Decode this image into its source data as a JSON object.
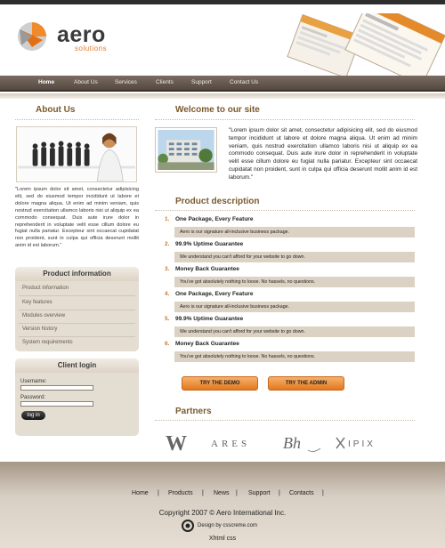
{
  "brand": {
    "name": "aero",
    "tagline": "solutions"
  },
  "nav": {
    "items": [
      {
        "label": "Home",
        "active": true
      },
      {
        "label": "About Us"
      },
      {
        "label": "Services"
      },
      {
        "label": "Clients"
      },
      {
        "label": "Support"
      },
      {
        "label": "Contact Us"
      }
    ]
  },
  "about": {
    "title": "About Us",
    "text": "\"Lorem ipsum dolor sit amet, consectetur adipisicing elit, sed do eiusmod tempor incididunt ut labore et dolore magna aliqua. Ut enim ad minim veniam, quis nostrud exercitation ullamco laboris nisi ut aliquip ex ea commodo consequat. Duis aute irure dolor in reprehenderit in voluptate velit esse cillum dolore eu fugiat nulla pariatur. Excepteur sint occaecat cupidatat non proident, sunt in culpa qui officia deserunt mollit anim id est laborum.\""
  },
  "product_info": {
    "title": "Product information",
    "items": [
      "Product information",
      "Key features",
      "Modules overview",
      "Version history",
      "System requirements"
    ]
  },
  "login": {
    "title": "Client login",
    "username_label": "Username:",
    "password_label": "Password:",
    "button_label": "log in"
  },
  "welcome": {
    "title": "Welcome to our site",
    "text": "\"Lorem ipsum dolor sit amet, consectetur adipisicing elit, sed do eiusmod tempor incididunt ut labore et dolore magna aliqua. Ut enim ad minim veniam, quis nostrud exercitation ullamco laboris nisi ut aliquip ex ea commodo consequat. Duis aute irure dolor in reprehenderit in voluptate velit esse cillum dolore eu fugiat nulla pariatur. Excepteur sint occaecat cupidatat non proident, sunt in culpa qui officia deserunt mollit anim id est laborum.\""
  },
  "product_description": {
    "title": "Product description",
    "items": [
      {
        "num": "1.",
        "title": "One Package, Every Feature",
        "text": "Aero is our signature all-inclusive business package."
      },
      {
        "num": "2.",
        "title": "99.9% Uptime Guarantee",
        "text": "We understand you can't afford for your website to go down."
      },
      {
        "num": "3.",
        "title": "Money Back Guarantee",
        "text": "You've got absolutely nothing to loose. No hassels, no questions."
      },
      {
        "num": "4.",
        "title": "One Package, Every Feature",
        "text": "Aero is our signature all-inclusive business package."
      },
      {
        "num": "5.",
        "title": "99.9% Uptime Guarantee",
        "text": "We understand you can't afford for your website to go down."
      },
      {
        "num": "6.",
        "title": "Money Back Guarantee",
        "text": "You've got absolutely nothing to loose. No hassels, no questions."
      }
    ]
  },
  "buttons": {
    "demo": "TRY THE DEMO",
    "admin": "TRY THE ADMIN"
  },
  "partners": {
    "title": "Partners",
    "logos": [
      "W",
      "ARES",
      "Bh",
      "IPIX"
    ]
  },
  "footer": {
    "links": [
      "Home",
      "Products",
      "News",
      "Support",
      "Contacts"
    ],
    "copyright": "Copyright 2007 © Aero International Inc.",
    "design": "Design by csscreme.com",
    "validation": "Xhtml css"
  },
  "colors": {
    "accent_orange": "#e07b2c",
    "heading_brown": "#7a5a2e",
    "nav_bar": "#5e5148",
    "panel_bg": "#e4ddd2"
  }
}
